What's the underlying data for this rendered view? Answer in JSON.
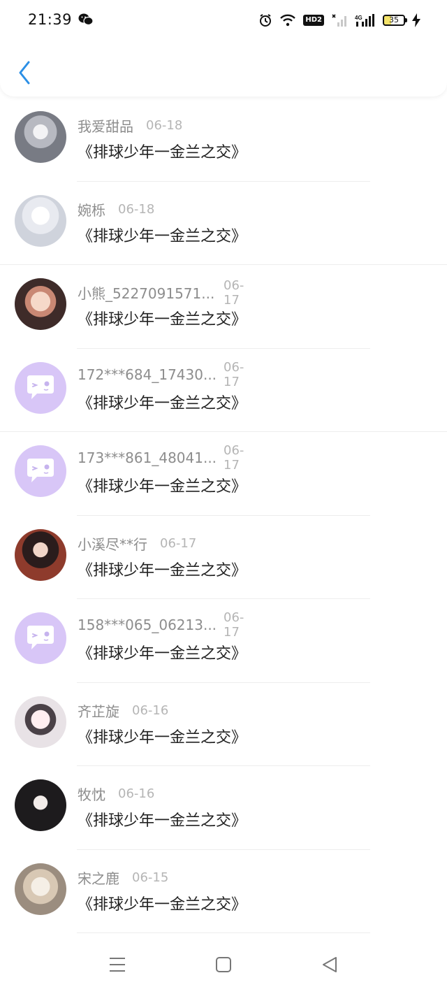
{
  "status_bar": {
    "time": "21:39",
    "network": "HD2",
    "signal_label": "4G",
    "battery_level": "35"
  },
  "header": {
    "back_icon": "chevron-left-icon"
  },
  "list": [
    {
      "name": "我爱甜品",
      "date": "06-18",
      "message": "《排球少年一金兰之交》",
      "avatar": "photo"
    },
    {
      "name": "婉栎",
      "date": "06-18",
      "message": "《排球少年一金兰之交》",
      "avatar": "photo"
    },
    {
      "name": "小熊_5227091571...",
      "date": "06-17",
      "message": "《排球少年一金兰之交》",
      "avatar": "photo"
    },
    {
      "name": "172***684_17430...",
      "date": "06-17",
      "message": "《排球少年一金兰之交》",
      "avatar": "default"
    },
    {
      "name": "173***861_48041...",
      "date": "06-17",
      "message": "《排球少年一金兰之交》",
      "avatar": "default"
    },
    {
      "name": "小溪尽**行",
      "date": "06-17",
      "message": "《排球少年一金兰之交》",
      "avatar": "photo"
    },
    {
      "name": "158***065_06213...",
      "date": "06-17",
      "message": "《排球少年一金兰之交》",
      "avatar": "default"
    },
    {
      "name": "齐芷旋",
      "date": "06-16",
      "message": "《排球少年一金兰之交》",
      "avatar": "photo"
    },
    {
      "name": "牧忱",
      "date": "06-16",
      "message": "《排球少年一金兰之交》",
      "avatar": "photo"
    },
    {
      "name": "宋之鹿",
      "date": "06-15",
      "message": "《排球少年一金兰之交》",
      "avatar": "photo"
    }
  ],
  "colors": {
    "accent": "#2b8fe6",
    "default_avatar_bg": "#d8c6f7"
  },
  "nav_bar": {
    "icons": [
      "menu-icon",
      "home-square-icon",
      "back-triangle-icon"
    ]
  }
}
